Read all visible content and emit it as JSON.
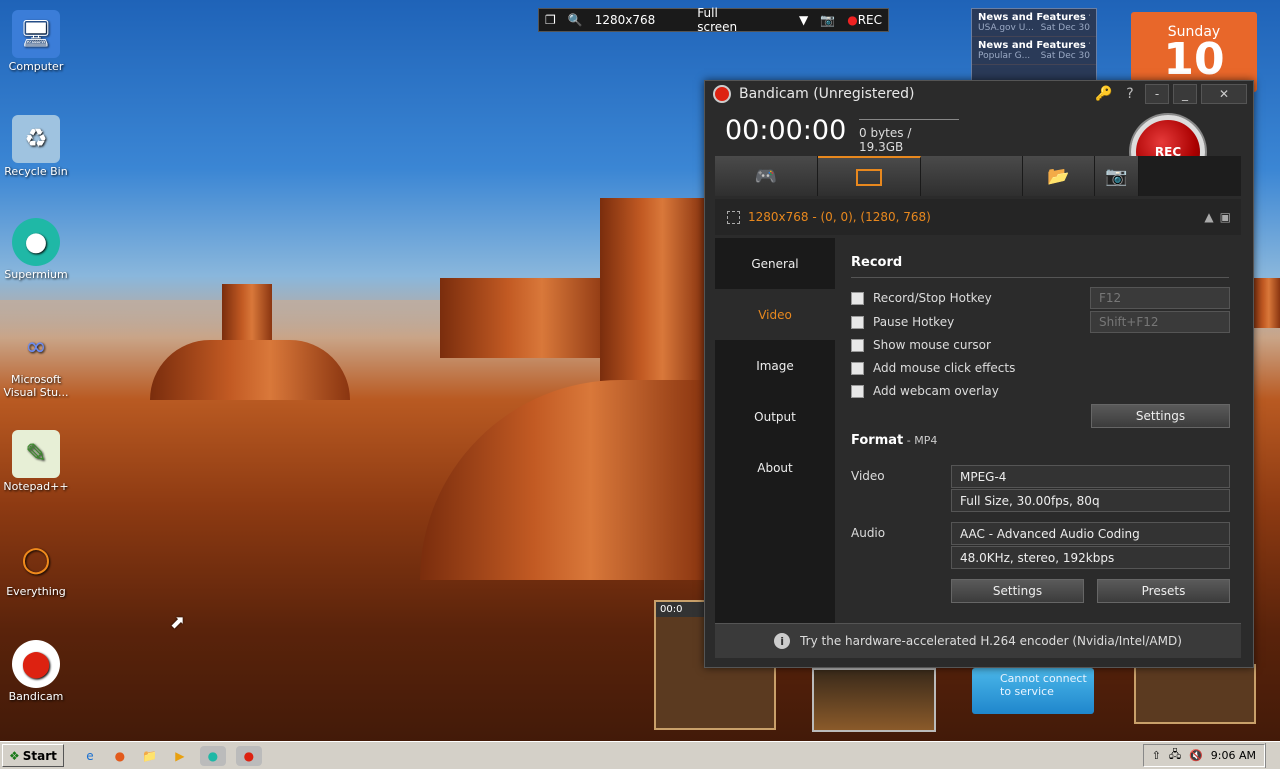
{
  "desktop": {
    "icons": [
      {
        "label": "Computer",
        "icon": "computer-icon"
      },
      {
        "label": "Recycle Bin",
        "icon": "recycle-bin-icon"
      },
      {
        "label": "Supermium",
        "icon": "supermium-icon"
      },
      {
        "label": "Microsoft Visual Stu...",
        "icon": "visual-studio-icon"
      },
      {
        "label": "Notepad++",
        "icon": "notepadpp-icon"
      },
      {
        "label": "Everything",
        "icon": "everything-icon"
      },
      {
        "label": "Bandicam",
        "icon": "bandicam-icon"
      }
    ]
  },
  "capture_bar": {
    "resolution": "1280x768",
    "mode": "Full screen",
    "rec_label": "REC"
  },
  "news_gadget": {
    "items": [
      {
        "title": "News and Features f...",
        "source": "USA.gov U...",
        "date": "Sat Dec 30"
      },
      {
        "title": "News and Features f...",
        "source": "Popular G...",
        "date": "Sat Dec 30"
      }
    ]
  },
  "calendar_gadget": {
    "day": "Sunday",
    "number": "10"
  },
  "bandicam": {
    "title": "Bandicam (Unregistered)",
    "timer": "00:00:00",
    "filesize": "0 bytes / 19.3GB",
    "rec_label": "REC",
    "area_text": "1280x768 - (0, 0), (1280, 768)",
    "sidebar": [
      {
        "label": "General"
      },
      {
        "label": "Video"
      },
      {
        "label": "Image"
      },
      {
        "label": "Output"
      },
      {
        "label": "About"
      }
    ],
    "record": {
      "heading": "Record",
      "options": [
        {
          "label": "Record/Stop Hotkey",
          "checked": false
        },
        {
          "label": "Pause Hotkey",
          "checked": false
        },
        {
          "label": "Show mouse cursor",
          "checked": false
        },
        {
          "label": "Add mouse click effects",
          "checked": false
        },
        {
          "label": "Add webcam overlay",
          "checked": false
        }
      ],
      "hotkey_record": "F12",
      "hotkey_pause": "Shift+F12",
      "settings_label": "Settings"
    },
    "format": {
      "heading": "Format",
      "type": " - MP4",
      "video_label": "Video",
      "video_codec": "MPEG-4",
      "video_detail": "Full Size, 30.00fps, 80q",
      "audio_label": "Audio",
      "audio_codec": "AAC - Advanced Audio Coding",
      "audio_detail": "48.0KHz, stereo, 192kbps",
      "settings_label": "Settings",
      "presets_label": "Presets"
    },
    "hint": "Try the hardware-accelerated H.264 encoder (Nvidia/Intel/AMD)"
  },
  "gadgets": {
    "cannot_connect": "Cannot connect to service",
    "thumb_timer": "00:0"
  },
  "taskbar": {
    "start_label": "Start",
    "time": "9:06 AM"
  }
}
